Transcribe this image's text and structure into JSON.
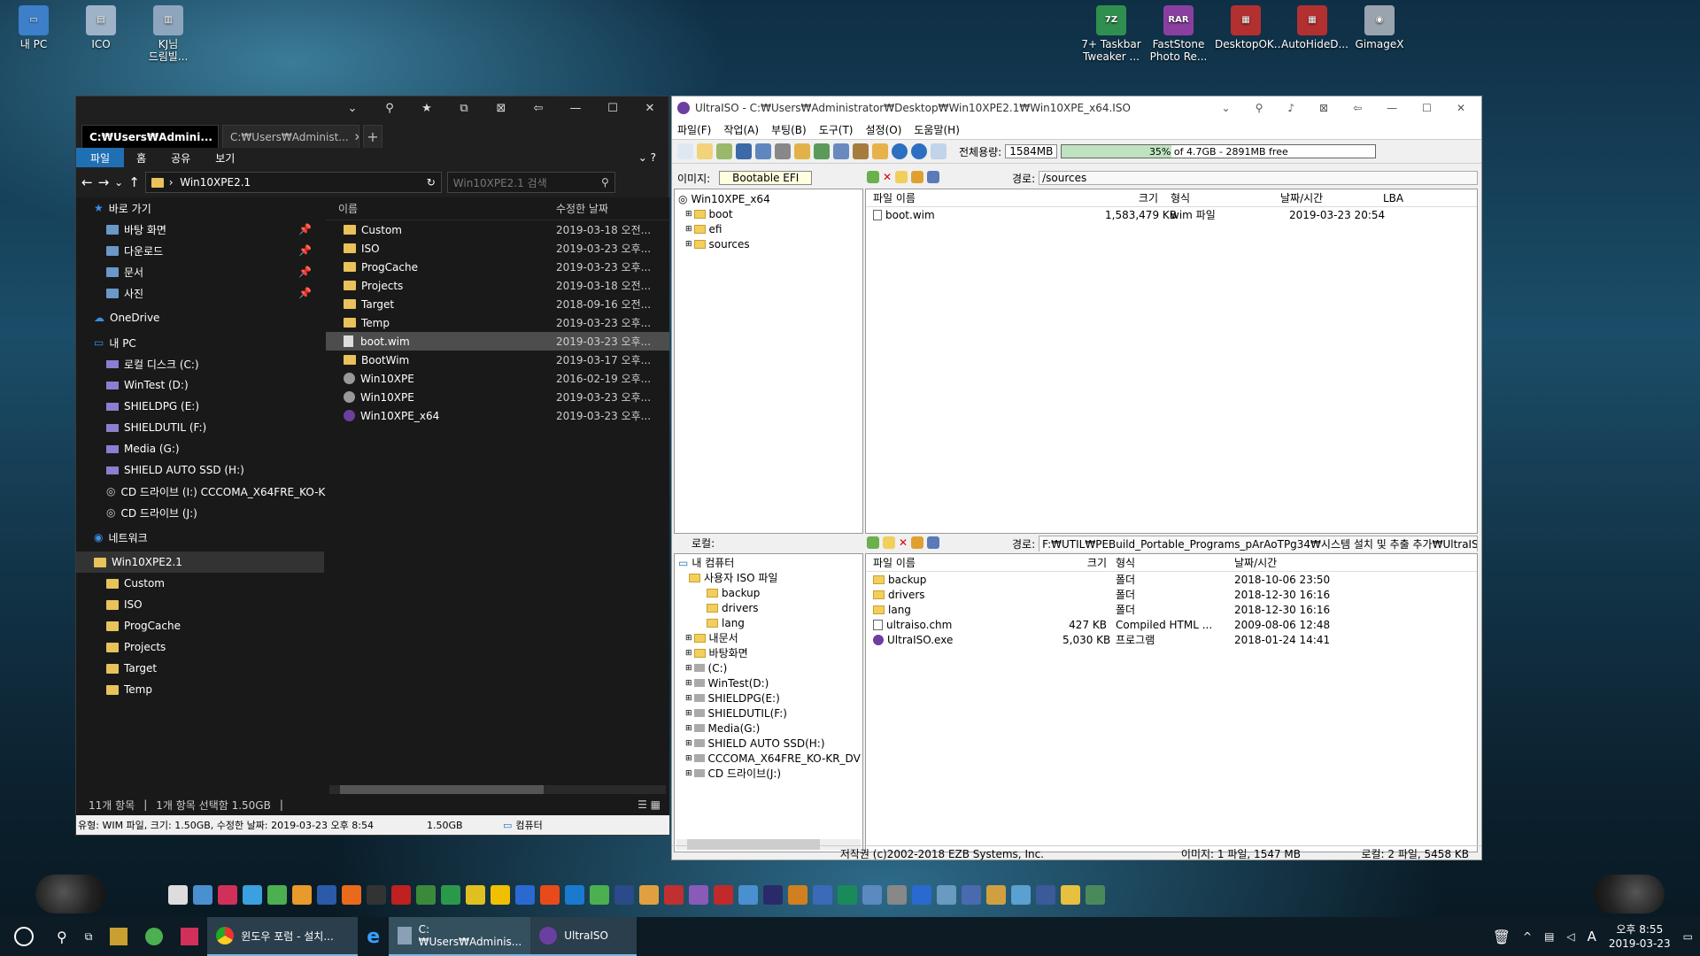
{
  "desktop_icons": [
    {
      "label": "내 PC",
      "icon": "pc-icon"
    },
    {
      "label": "ICO",
      "icon": "folder-icon"
    },
    {
      "label": "KJ님\n드림빌...",
      "icon": "file-icon"
    },
    {
      "label": "7+ Taskbar\nTweaker ...",
      "icon": "7z-icon"
    },
    {
      "label": "FastStone\nPhoto Re...",
      "icon": "rar-icon"
    },
    {
      "label": "DesktopOK...",
      "icon": "winrar-icon"
    },
    {
      "label": "AutoHideD...",
      "icon": "winrar-icon"
    },
    {
      "label": "GimageX",
      "icon": "disk-icon"
    }
  ],
  "explorer": {
    "tabs": [
      "C:₩Users₩Admini...",
      "C:₩Users₩Administ..."
    ],
    "ribbon": [
      "파일",
      "홈",
      "공유",
      "보기"
    ],
    "path": "Win10XPE2.1",
    "search_placeholder": "Win10XPE2.1 검색",
    "col_name": "이름",
    "col_date": "수정한 날짜",
    "nav": [
      {
        "label": "바로 가기",
        "kind": "star"
      },
      {
        "label": "바탕 화면",
        "kind": "folder"
      },
      {
        "label": "다운로드",
        "kind": "folder"
      },
      {
        "label": "문서",
        "kind": "folder"
      },
      {
        "label": "사진",
        "kind": "folder"
      },
      {
        "label": "OneDrive",
        "kind": "cloud"
      },
      {
        "label": "내 PC",
        "kind": "pc"
      },
      {
        "label": "로컬 디스크 (C:)",
        "kind": "drive"
      },
      {
        "label": "WinTest (D:)",
        "kind": "drive"
      },
      {
        "label": "SHIELDPG (E:)",
        "kind": "drive"
      },
      {
        "label": "SHIELDUTIL (F:)",
        "kind": "drive"
      },
      {
        "label": "Media (G:)",
        "kind": "drive"
      },
      {
        "label": "SHIELD AUTO SSD (H:)",
        "kind": "drive"
      },
      {
        "label": "CD 드라이브 (I:) CCCOMA_X64FRE_KO-KR",
        "kind": "cd"
      },
      {
        "label": "CD 드라이브 (J:)",
        "kind": "cd"
      },
      {
        "label": "네트워크",
        "kind": "net"
      },
      {
        "label": "Win10XPE2.1",
        "kind": "folder"
      },
      {
        "label": "Custom",
        "kind": "folder"
      },
      {
        "label": "ISO",
        "kind": "folder"
      },
      {
        "label": "ProgCache",
        "kind": "folder"
      },
      {
        "label": "Projects",
        "kind": "folder"
      },
      {
        "label": "Target",
        "kind": "folder"
      },
      {
        "label": "Temp",
        "kind": "folder"
      }
    ],
    "files": [
      {
        "name": "Custom",
        "date": "2019-03-18 오전..."
      },
      {
        "name": "ISO",
        "date": "2019-03-23 오후..."
      },
      {
        "name": "ProgCache",
        "date": "2019-03-23 오후..."
      },
      {
        "name": "Projects",
        "date": "2019-03-18 오전..."
      },
      {
        "name": "Target",
        "date": "2018-09-16 오전..."
      },
      {
        "name": "Temp",
        "date": "2019-03-23 오후..."
      },
      {
        "name": "boot.wim",
        "date": "2019-03-23 오후..."
      },
      {
        "name": "BootWim",
        "date": "2019-03-17 오후..."
      },
      {
        "name": "Win10XPE",
        "date": "2016-02-19 오후..."
      },
      {
        "name": "Win10XPE",
        "date": "2019-03-23 오후..."
      },
      {
        "name": "Win10XPE_x64",
        "date": "2019-03-23 오후..."
      }
    ],
    "status_count": "11개 항목",
    "status_sel": "1개 항목 선택함 1.50GB",
    "info_text": "유형: WIM 파일, 크기: 1.50GB, 수정한 날짜: 2019-03-23 오후 8:54",
    "info_size": "1.50GB",
    "info_pc": "컴퓨터"
  },
  "ultraiso": {
    "title": "UltraISO - C:₩Users₩Administrator₩Desktop₩Win10XPE2.1₩Win10XPE_x64.ISO",
    "menu": [
      "파일(F)",
      "작업(A)",
      "부팅(B)",
      "도구(T)",
      "설정(O)",
      "도움말(H)"
    ],
    "total_label": "전체용량:",
    "total_value": "1584MB",
    "progress_text": "35% of 4.7GB - 2891MB free",
    "progress": 0.35,
    "image_label": "이미지:",
    "image_value": "Bootable EFI",
    "path_label": "경로:",
    "path_value": "/sources",
    "iso_tree": [
      "Win10XPE_x64",
      "boot",
      "efi",
      "sources"
    ],
    "iso_cols": [
      "파일 이름",
      "크기",
      "형식",
      "날짜/시간",
      "LBA"
    ],
    "iso_files": [
      {
        "name": "boot.wim",
        "size": "1,583,479 KB",
        "type": "wim 파일",
        "date": "2019-03-23 20:54"
      }
    ],
    "local_label": "로컬:",
    "local_path_label": "경로:",
    "local_path": "F:₩UTIL₩PEBuild_Portable_Programs_pArAoTPg34₩시스템 설치 및 추출 추가₩UltraISO",
    "local_tree": [
      "내 컴퓨터",
      "사용자 ISO 파일",
      "backup",
      "drivers",
      "lang",
      "내문서",
      "바탕화면",
      "(C:)",
      "WinTest(D:)",
      "SHIELDPG(E:)",
      "SHIELDUTIL(F:)",
      "Media(G:)",
      "SHIELD AUTO SSD(H:)",
      "CCCOMA_X64FRE_KO-KR_DV",
      "CD 드라이브(J:)"
    ],
    "local_cols": [
      "파일 이름",
      "크기",
      "형식",
      "날짜/시간"
    ],
    "local_files": [
      {
        "name": "backup",
        "size": "",
        "type": "폴더",
        "date": "2018-10-06 23:50"
      },
      {
        "name": "drivers",
        "size": "",
        "type": "폴더",
        "date": "2018-12-30 16:16"
      },
      {
        "name": "lang",
        "size": "",
        "type": "폴더",
        "date": "2018-12-30 16:16"
      },
      {
        "name": "ultraiso.chm",
        "size": "427 KB",
        "type": "Compiled HTML ...",
        "date": "2009-08-06 12:48"
      },
      {
        "name": "UltraISO.exe",
        "size": "5,030 KB",
        "type": "프로그램",
        "date": "2018-01-24 14:41"
      }
    ],
    "status_copy": "저작권 (c)2002-2018 EZB Systems, Inc.",
    "status_image": "이미지: 1 파일, 1547 MB",
    "status_local": "로컬: 2 파일, 5458 KB"
  },
  "taskbar": {
    "items": [
      "윈도우 포럼 - 설치...",
      "C:₩Users₩Adminis...",
      "UltraISO"
    ],
    "ime": "A",
    "time": "오후 8:55",
    "date": "2019-03-23"
  },
  "colors": {
    "accent": "#1f6fb3",
    "explorer_bg": "#191919",
    "progress": "#bfe3bf"
  }
}
